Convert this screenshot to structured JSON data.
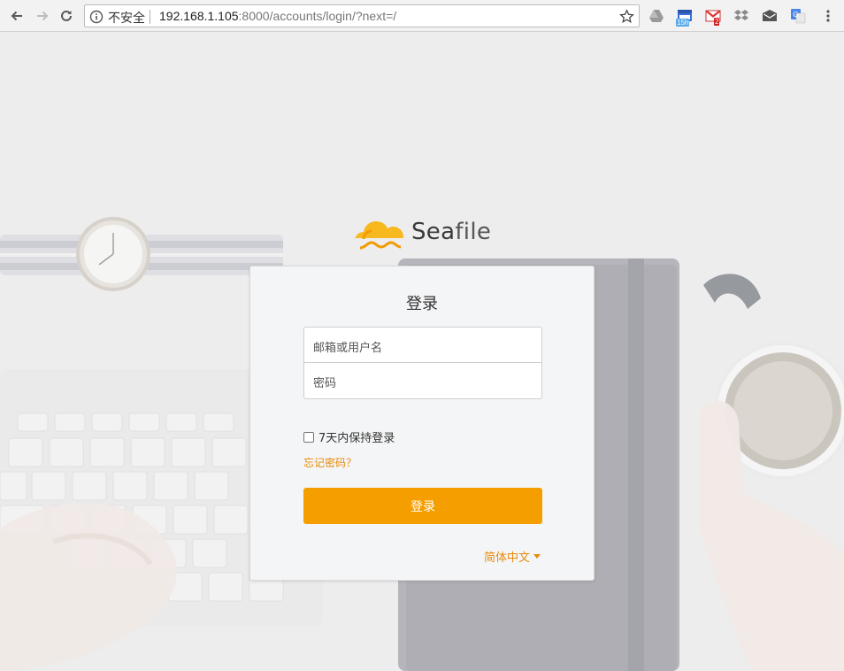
{
  "browser": {
    "security_label": "不安全",
    "url_host": "192.168.1.105",
    "url_path": ":8000/accounts/login/?next=/",
    "calendar_badge": "15h",
    "gmail_badge": "2"
  },
  "logo": {
    "name_a": "Sea",
    "name_b": "file"
  },
  "login": {
    "title": "登录",
    "username_placeholder": "邮箱或用户名",
    "password_placeholder": "密码",
    "remember_label": "7天内保持登录",
    "forgot_link": "忘记密码？",
    "submit_label": "登录",
    "language": "简体中文"
  },
  "colors": {
    "accent": "#f59e00",
    "link": "#e78a0b"
  }
}
